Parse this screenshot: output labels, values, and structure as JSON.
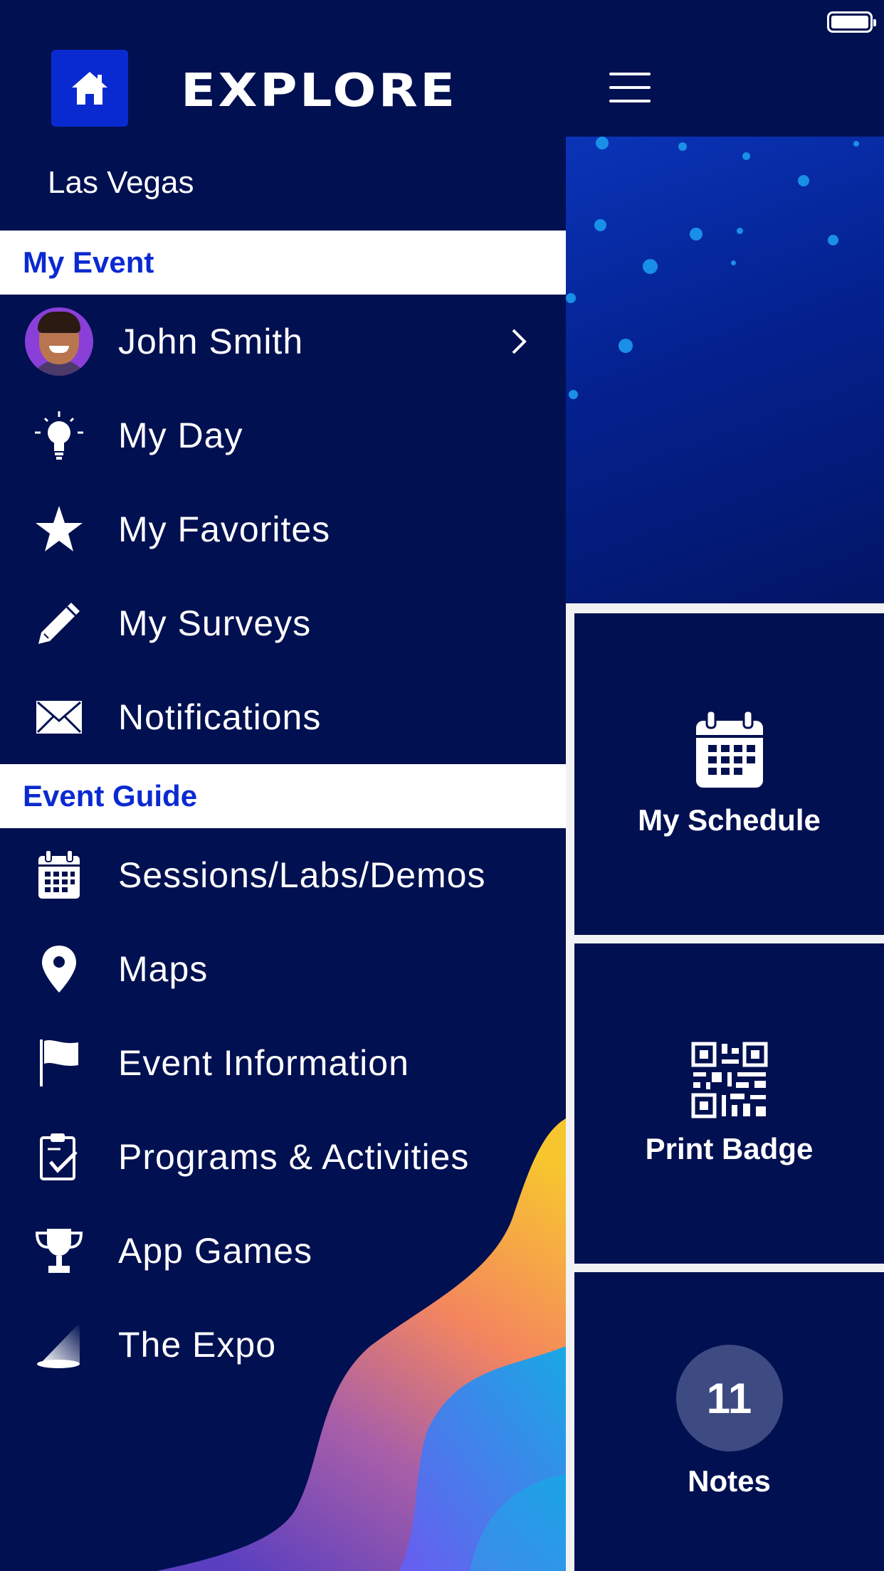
{
  "header": {
    "logo_text": "EXPLORE",
    "home_icon": "home-icon",
    "menu_icon": "hamburger-menu-icon"
  },
  "drawer": {
    "location": "Las Vegas",
    "sections": [
      {
        "title": "My Event",
        "items": [
          {
            "label": "John Smith",
            "icon": "avatar"
          },
          {
            "label": "My Day",
            "icon": "lightbulb-icon"
          },
          {
            "label": "My Favorites",
            "icon": "star-icon"
          },
          {
            "label": "My Surveys",
            "icon": "pencil-icon"
          },
          {
            "label": "Notifications",
            "icon": "envelope-icon"
          }
        ]
      },
      {
        "title": "Event Guide",
        "items": [
          {
            "label": "Sessions/Labs/Demos",
            "icon": "calendar-icon"
          },
          {
            "label": "Maps",
            "icon": "map-pin-icon"
          },
          {
            "label": "Event Information",
            "icon": "flag-icon"
          },
          {
            "label": "Programs & Activities",
            "icon": "clipboard-check-icon"
          },
          {
            "label": "App Games",
            "icon": "trophy-icon"
          },
          {
            "label": "The Expo",
            "icon": "spotlight-icon"
          }
        ]
      }
    ]
  },
  "tiles": [
    {
      "label": "My Schedule",
      "icon": "calendar-icon"
    },
    {
      "label": "Print Badge",
      "icon": "qr-code-icon"
    },
    {
      "label": "Notes",
      "count": "11"
    }
  ],
  "colors": {
    "navy": "#011051",
    "accent_blue": "#0a2ad1",
    "white": "#ffffff"
  }
}
